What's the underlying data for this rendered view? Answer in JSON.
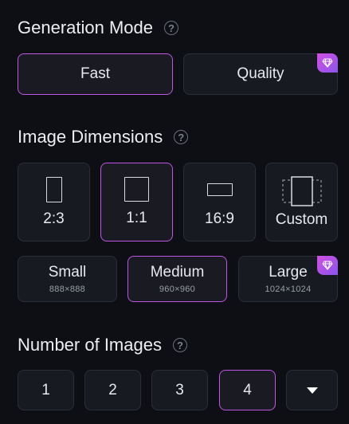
{
  "generation_mode": {
    "title": "Generation Mode",
    "help": "?",
    "options": [
      {
        "label": "Fast",
        "selected": true,
        "premium": false
      },
      {
        "label": "Quality",
        "selected": false,
        "premium": true
      }
    ]
  },
  "image_dimensions": {
    "title": "Image Dimensions",
    "help": "?",
    "ratios": [
      {
        "label": "2:3",
        "selected": false
      },
      {
        "label": "1:1",
        "selected": true
      },
      {
        "label": "16:9",
        "selected": false
      },
      {
        "label": "Custom",
        "selected": false
      }
    ],
    "sizes": [
      {
        "label": "Small",
        "dims": "888×888",
        "selected": false,
        "premium": false
      },
      {
        "label": "Medium",
        "dims": "960×960",
        "selected": true,
        "premium": false
      },
      {
        "label": "Large",
        "dims": "1024×1024",
        "selected": false,
        "premium": true
      }
    ]
  },
  "number_of_images": {
    "title": "Number of Images",
    "help": "?",
    "options": [
      {
        "label": "1",
        "selected": false
      },
      {
        "label": "2",
        "selected": false
      },
      {
        "label": "3",
        "selected": false
      },
      {
        "label": "4",
        "selected": true
      }
    ],
    "more_icon": "caret-down-icon"
  },
  "colors": {
    "accent": "#c054e6",
    "premium_gradient_start": "#d24fe0",
    "premium_gradient_end": "#8a55ee"
  }
}
